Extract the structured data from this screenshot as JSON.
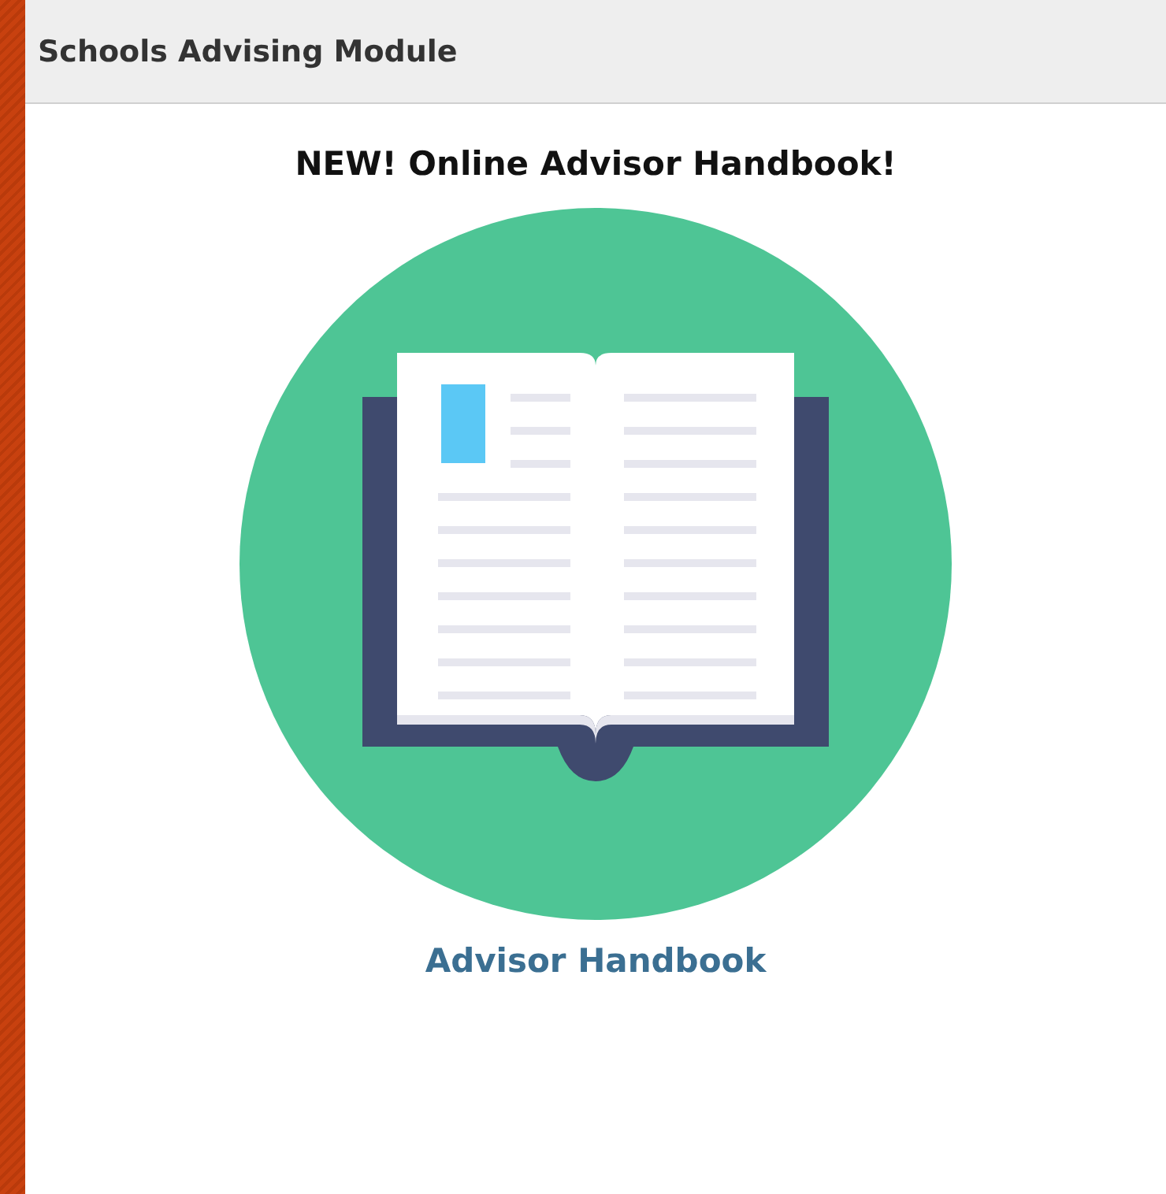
{
  "header": {
    "title": "Schools Advising Module"
  },
  "content": {
    "heading": "NEW! Online Advisor Handbook!",
    "link": "Advisor Handbook"
  }
}
